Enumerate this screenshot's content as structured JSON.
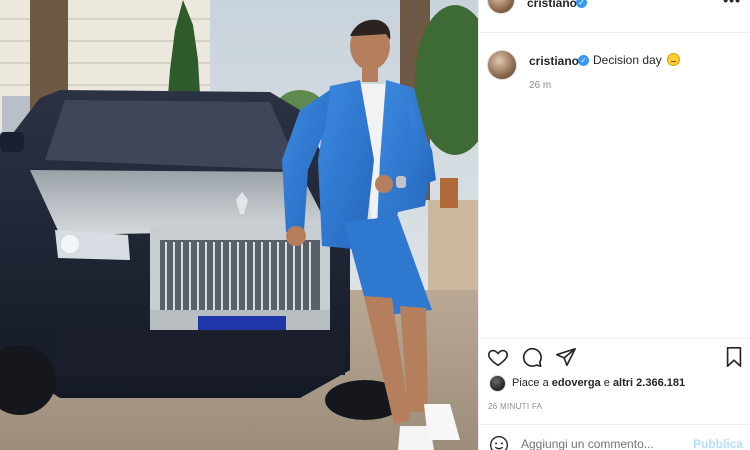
{
  "post": {
    "username": "cristiano",
    "verified_symbol": "✓",
    "more_label": "•••",
    "caption": {
      "text": "Decision day",
      "time": "26 m"
    },
    "likes": {
      "prefix": "Piace a",
      "user": "edoverga",
      "middle": "e",
      "count": "altri 2.366.181"
    },
    "time_caps": "26 MINUTI FA",
    "comment": {
      "placeholder": "Aggiungi un commento...",
      "publish_label": "Pubblica"
    }
  },
  "icons": {
    "like": "heart-icon",
    "comment": "comment-icon",
    "share": "send-icon",
    "save": "bookmark-icon",
    "emoji": "smiley-icon"
  },
  "colors": {
    "verified": "#3897f0",
    "publish_disabled": "#b2dffc",
    "muted_text": "#8e8e8e",
    "suit_blue": "#2f7bd4"
  }
}
